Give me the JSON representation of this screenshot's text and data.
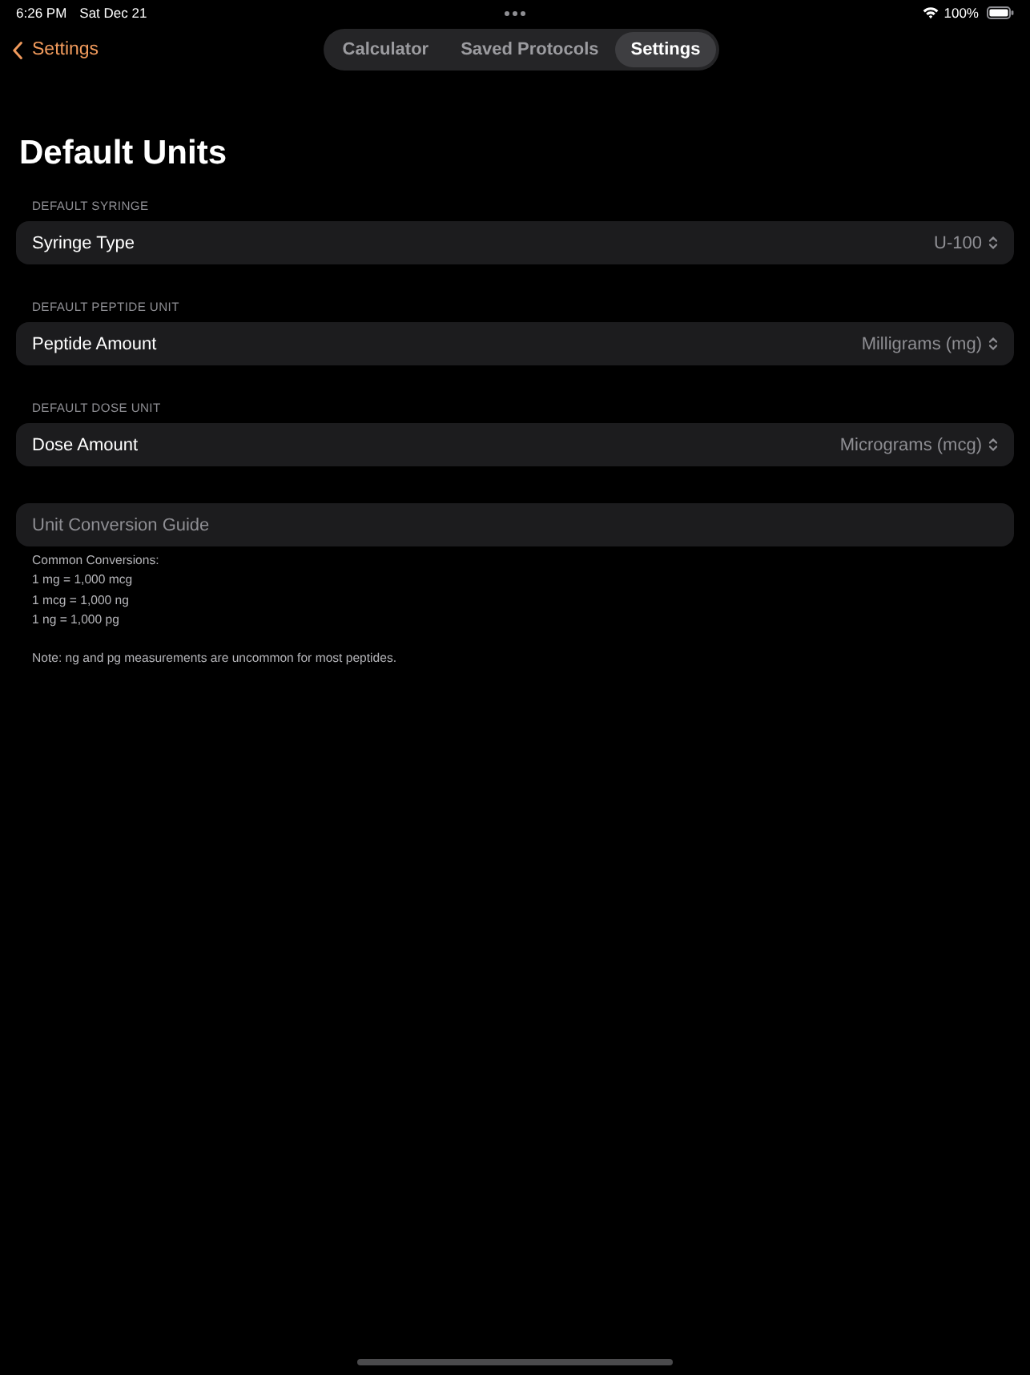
{
  "status_bar": {
    "time": "6:26 PM",
    "date": "Sat Dec 21",
    "battery": "100%"
  },
  "nav": {
    "back_label": "Settings",
    "tabs": [
      {
        "label": "Calculator",
        "selected": false
      },
      {
        "label": "Saved Protocols",
        "selected": false
      },
      {
        "label": "Settings",
        "selected": true
      }
    ]
  },
  "title": "Default Units",
  "sections": [
    {
      "header": "DEFAULT SYRINGE",
      "label": "Syringe Type",
      "value": "U-100"
    },
    {
      "header": "DEFAULT PEPTIDE UNIT",
      "label": "Peptide Amount",
      "value": "Milligrams (mg)"
    },
    {
      "header": "DEFAULT DOSE UNIT",
      "label": "Dose Amount",
      "value": "Micrograms (mcg)"
    }
  ],
  "guide": {
    "title": "Unit Conversion Guide",
    "lines": [
      "Common Conversions:",
      "1 mg = 1,000 mcg",
      "1 mcg = 1,000 ng",
      "1 ng = 1,000 pg"
    ],
    "note": "Note: ng and pg measurements are uncommon for most peptides."
  }
}
